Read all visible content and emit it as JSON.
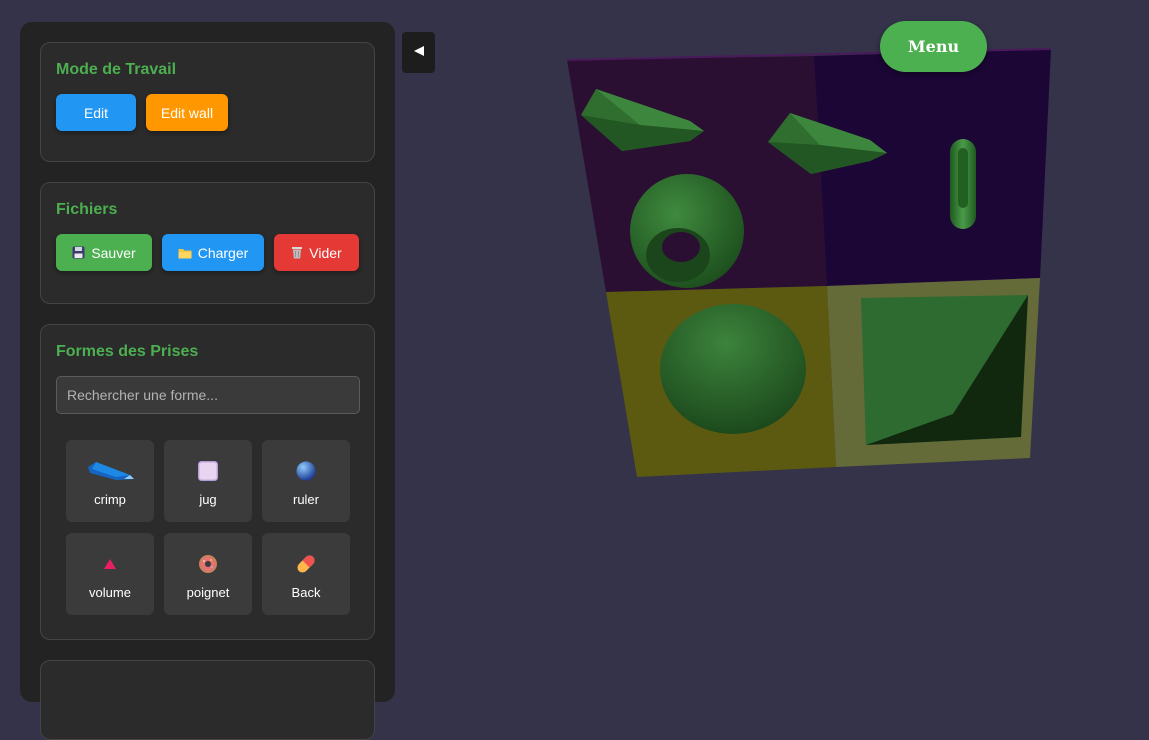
{
  "work_mode": {
    "title": "Mode de Travail",
    "edit_label": "Edit",
    "edit_wall_label": "Edit wall"
  },
  "files": {
    "title": "Fichiers",
    "save_label": "Sauver",
    "load_label": "Charger",
    "clear_label": "Vider"
  },
  "holds": {
    "title": "Formes des Prises",
    "search_placeholder": "Rechercher une forme...",
    "shapes": [
      {
        "label": "crimp",
        "icon": "crimp-shape-icon"
      },
      {
        "label": "jug",
        "icon": "jug-square-icon"
      },
      {
        "label": "ruler",
        "icon": "ruler-sphere-icon"
      },
      {
        "label": "volume",
        "icon": "volume-triangle-icon"
      },
      {
        "label": "poignet",
        "icon": "donut-icon"
      },
      {
        "label": "Back",
        "icon": "pill-icon"
      }
    ]
  },
  "menu_label": "Menu",
  "colors": {
    "background": "#34334a",
    "sidebar": "#232323",
    "accent_green": "#4caf50",
    "blue": "#2196f3",
    "orange": "#ff9800",
    "red": "#e53935",
    "hold_green": "#2e6b2e",
    "wall_panel_purple": "#2a0f33",
    "wall_panel_violet": "#1c0636",
    "wall_panel_olive": "#5c5a10",
    "wall_panel_khaki": "#646a38"
  }
}
